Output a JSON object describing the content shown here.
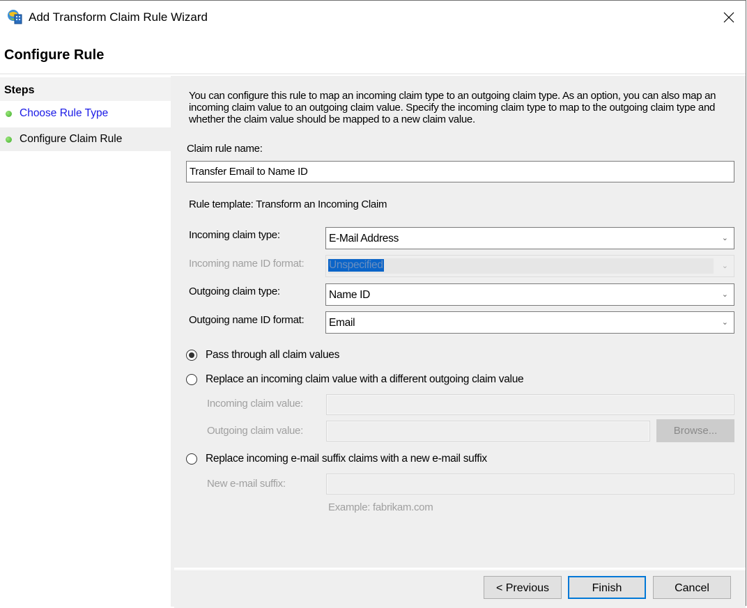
{
  "window": {
    "title": "Add Transform Claim Rule Wizard",
    "app_icon": "wizard-globe-server-icon",
    "close_icon": "close-icon"
  },
  "header": {
    "title": "Configure Rule"
  },
  "steps": {
    "heading": "Steps",
    "items": [
      {
        "label": "Choose Rule Type",
        "state": "link"
      },
      {
        "label": "Configure Claim Rule",
        "state": "active"
      }
    ]
  },
  "main": {
    "description": "You can configure this rule to map an incoming claim type to an outgoing claim type. As an option, you can also map an incoming claim value to an outgoing claim value. Specify the incoming claim type to map to the outgoing claim type and whether the claim value should be mapped to a new claim value.",
    "rule_name_label": "Claim rule name:",
    "rule_name_value": "Transfer Email to Name ID",
    "rule_template": "Rule template: Transform an Incoming Claim",
    "incoming_claim_type": {
      "label": "Incoming claim type:",
      "value": "E-Mail Address"
    },
    "incoming_name_id_format": {
      "label": "Incoming name ID format:",
      "value": "Unspecified",
      "disabled": true
    },
    "outgoing_claim_type": {
      "label": "Outgoing claim type:",
      "value": "Name ID"
    },
    "outgoing_name_id_format": {
      "label": "Outgoing name ID format:",
      "value": "Email"
    },
    "options": [
      {
        "label": "Pass through all claim values",
        "checked": true
      },
      {
        "label": "Replace an incoming claim value with a different outgoing claim value",
        "checked": false
      },
      {
        "label": "Replace incoming e-mail suffix claims with a new e-mail suffix",
        "checked": false
      }
    ],
    "incoming_claim_value": {
      "label": "Incoming claim value:",
      "value": ""
    },
    "outgoing_claim_value": {
      "label": "Outgoing claim value:",
      "value": ""
    },
    "browse_label": "Browse...",
    "new_suffix": {
      "label": "New e-mail suffix:",
      "value": ""
    },
    "example": "Example: fabrikam.com"
  },
  "footer": {
    "previous_label": "< Previous",
    "finish_label": "Finish",
    "cancel_label": "Cancel"
  },
  "colors": {
    "link": "#1a1ae6",
    "step_dot": "#3fae2b",
    "primary_border": "#0078d7",
    "selection": "#0a64c8"
  }
}
